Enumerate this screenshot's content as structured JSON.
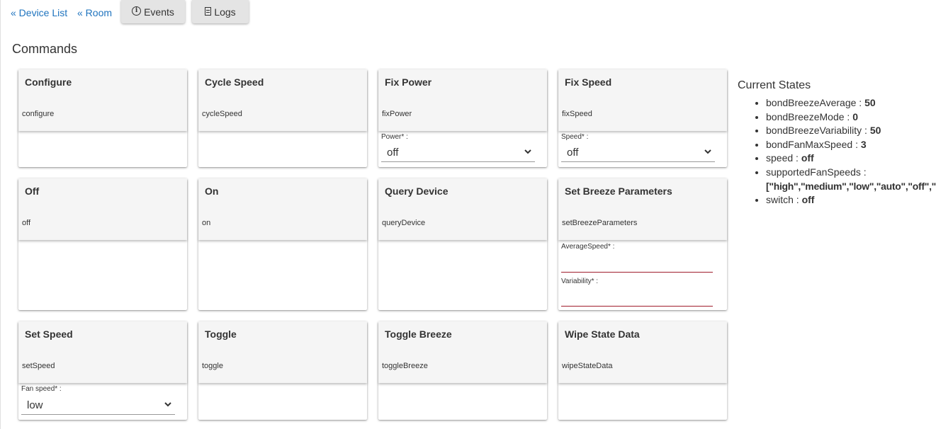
{
  "nav": {
    "device_list": "« Device List",
    "room": "« Room",
    "events": "Events",
    "logs": "Logs"
  },
  "commands_title": "Commands",
  "commands": [
    {
      "title": "Configure",
      "method": "configure"
    },
    {
      "title": "Cycle Speed",
      "method": "cycleSpeed"
    },
    {
      "title": "Fix Power",
      "method": "fixPower",
      "param_label": "Power* :",
      "param_value": "off"
    },
    {
      "title": "Fix Speed",
      "method": "fixSpeed",
      "param_label": "Speed* :",
      "param_value": "off"
    },
    {
      "title": "Off",
      "method": "off"
    },
    {
      "title": "On",
      "method": "on"
    },
    {
      "title": "Query Device",
      "method": "queryDevice"
    },
    {
      "title": "Set Breeze Parameters",
      "method": "setBreezeParameters",
      "param1_label": "AverageSpeed* :",
      "param2_label": "Variability* :"
    },
    {
      "title": "Set Speed",
      "method": "setSpeed",
      "param_label": "Fan speed* :",
      "param_value": "low"
    },
    {
      "title": "Toggle",
      "method": "toggle"
    },
    {
      "title": "Toggle Breeze",
      "method": "toggleBreeze"
    },
    {
      "title": "Wipe State Data",
      "method": "wipeStateData"
    }
  ],
  "states": {
    "title": "Current States",
    "items": [
      {
        "key": "bondBreezeAverage",
        "value": "50"
      },
      {
        "key": "bondBreezeMode",
        "value": "0"
      },
      {
        "key": "bondBreezeVariability",
        "value": "50"
      },
      {
        "key": "bondFanMaxSpeed",
        "value": "3"
      },
      {
        "key": "speed",
        "value": "off"
      },
      {
        "key": "supportedFanSpeeds",
        "value": "[\"high\",\"medium\",\"low\",\"auto\",\"off\",\"on\"]"
      },
      {
        "key": "switch",
        "value": "off"
      }
    ]
  },
  "colors": {
    "link": "#1e73be",
    "required_underline": "#a01c2c",
    "card_header": "#f5f5f5"
  }
}
